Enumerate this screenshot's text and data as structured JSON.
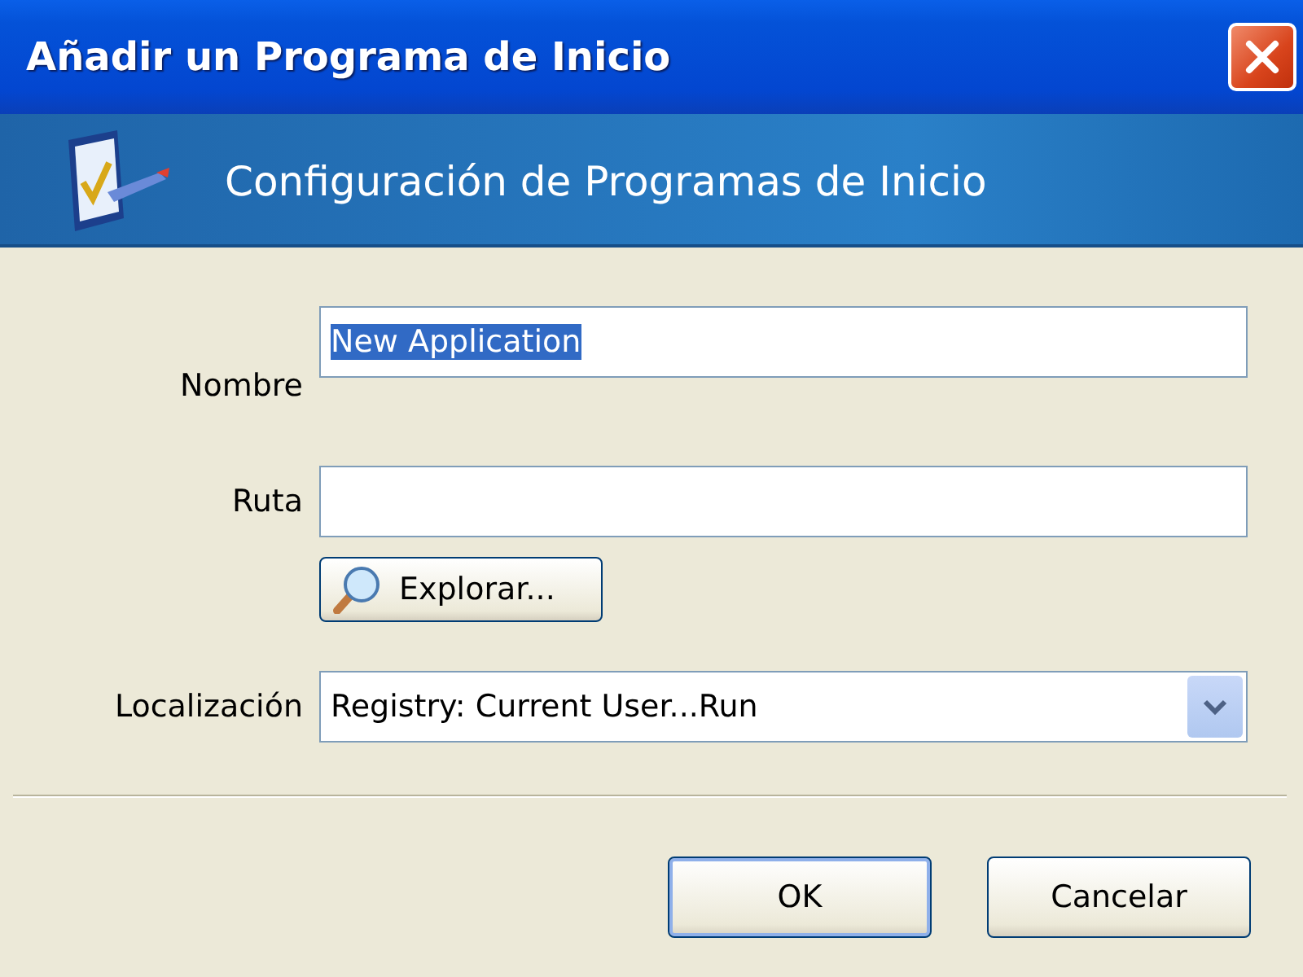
{
  "window": {
    "title": "Añadir un Programa de Inicio"
  },
  "banner": {
    "title": "Configuración de Programas de Inicio"
  },
  "fields": [
    {
      "kind": "text",
      "label": "Nombre",
      "value": "New Application",
      "text_selected": true
    },
    {
      "kind": "text",
      "label": "Ruta"
    },
    {
      "kind": "button",
      "label": "Explorar..."
    },
    {
      "kind": "dropdown",
      "label": "Localización",
      "value": "Registry: Current User...Run"
    }
  ],
  "buttons": [
    {
      "label": "OK",
      "default": true
    },
    {
      "label": "Cancelar",
      "default": false
    }
  ]
}
